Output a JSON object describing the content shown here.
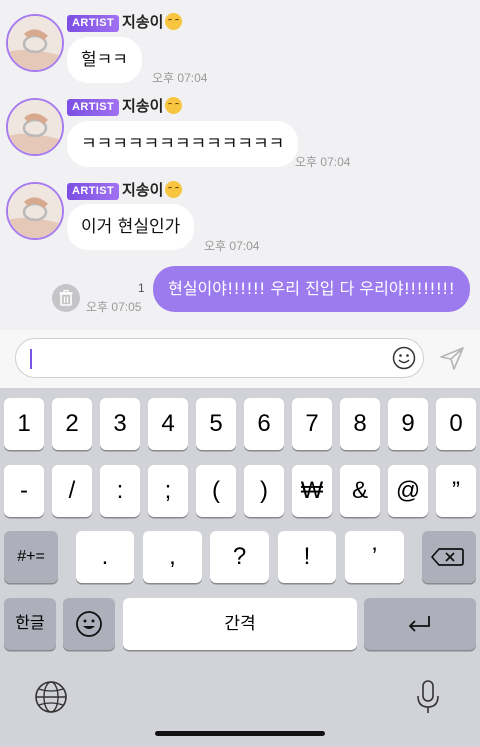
{
  "chat": {
    "messages": [
      {
        "badge": "ARTIST",
        "sender": "지송이",
        "text": "헐ㅋㅋ",
        "time": "오후 07:04"
      },
      {
        "badge": "ARTIST",
        "sender": "지송이",
        "text": "ㅋㅋㅋㅋㅋㅋㅋㅋㅋㅋㅋㅋㅋ",
        "time": "오후 07:04"
      },
      {
        "badge": "ARTIST",
        "sender": "지송이",
        "text": "이거 현실인가",
        "time": "오후 07:04"
      }
    ],
    "outgoing": {
      "text": "현실이야!!!!!! 우리 진입 다 우리야!!!!!!!!",
      "time": "오후 07:05",
      "unread_count": "1"
    }
  },
  "composer": {
    "placeholder": ""
  },
  "keyboard": {
    "row1": [
      "1",
      "2",
      "3",
      "4",
      "5",
      "6",
      "7",
      "8",
      "9",
      "0"
    ],
    "row2": [
      "-",
      "/",
      ":",
      ";",
      "(",
      ")",
      "₩",
      "&",
      "@",
      "”"
    ],
    "row3": {
      "mode": "#+=",
      "keys": [
        ".",
        ",",
        "?",
        "!",
        "’"
      ]
    },
    "row4": {
      "lang": "한글",
      "space": "간격"
    }
  },
  "colors": {
    "accent": "#9c7bef",
    "badge": "#8a5cef",
    "keyboard_bg": "#d2d3d8"
  }
}
